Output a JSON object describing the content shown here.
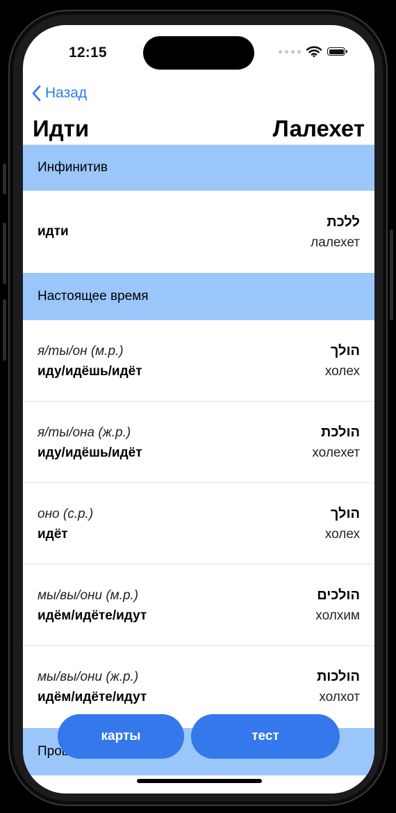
{
  "status_bar": {
    "time": "12:15"
  },
  "nav": {
    "back_label": "Назад"
  },
  "title": {
    "left": "Идти",
    "right": "Лалехет"
  },
  "sections": [
    {
      "header": "Инфинитив",
      "rows": [
        {
          "pronoun": "",
          "verb": "идти",
          "hebrew": "ללכת",
          "translit": "лалехет"
        }
      ]
    },
    {
      "header": "Настоящее время",
      "rows": [
        {
          "pronoun": "я/ты/он (м.р.)",
          "verb": "иду/идёшь/идёт",
          "hebrew": "הולך",
          "translit": "холех"
        },
        {
          "pronoun": "я/ты/она (ж.р.)",
          "verb": "иду/идёшь/идёт",
          "hebrew": "הולכת",
          "translit": "холехет"
        },
        {
          "pronoun": "оно (с.р.)",
          "verb": "идёт",
          "hebrew": "הולך",
          "translit": "холех"
        },
        {
          "pronoun": "мы/вы/они (м.р.)",
          "verb": "идём/идёте/идут",
          "hebrew": "הולכים",
          "translit": "холхим"
        },
        {
          "pronoun": "мы/вы/они (ж.р.)",
          "verb": "идём/идёте/идут",
          "hebrew": "הולכות",
          "translit": "холхот"
        }
      ]
    },
    {
      "header": "Прошедшее время",
      "rows": []
    }
  ],
  "buttons": {
    "cards": "карты",
    "test": "тест"
  },
  "colors": {
    "accent": "#3478ec",
    "section_bg": "#9bc6fa",
    "link": "#2d7cf0"
  }
}
